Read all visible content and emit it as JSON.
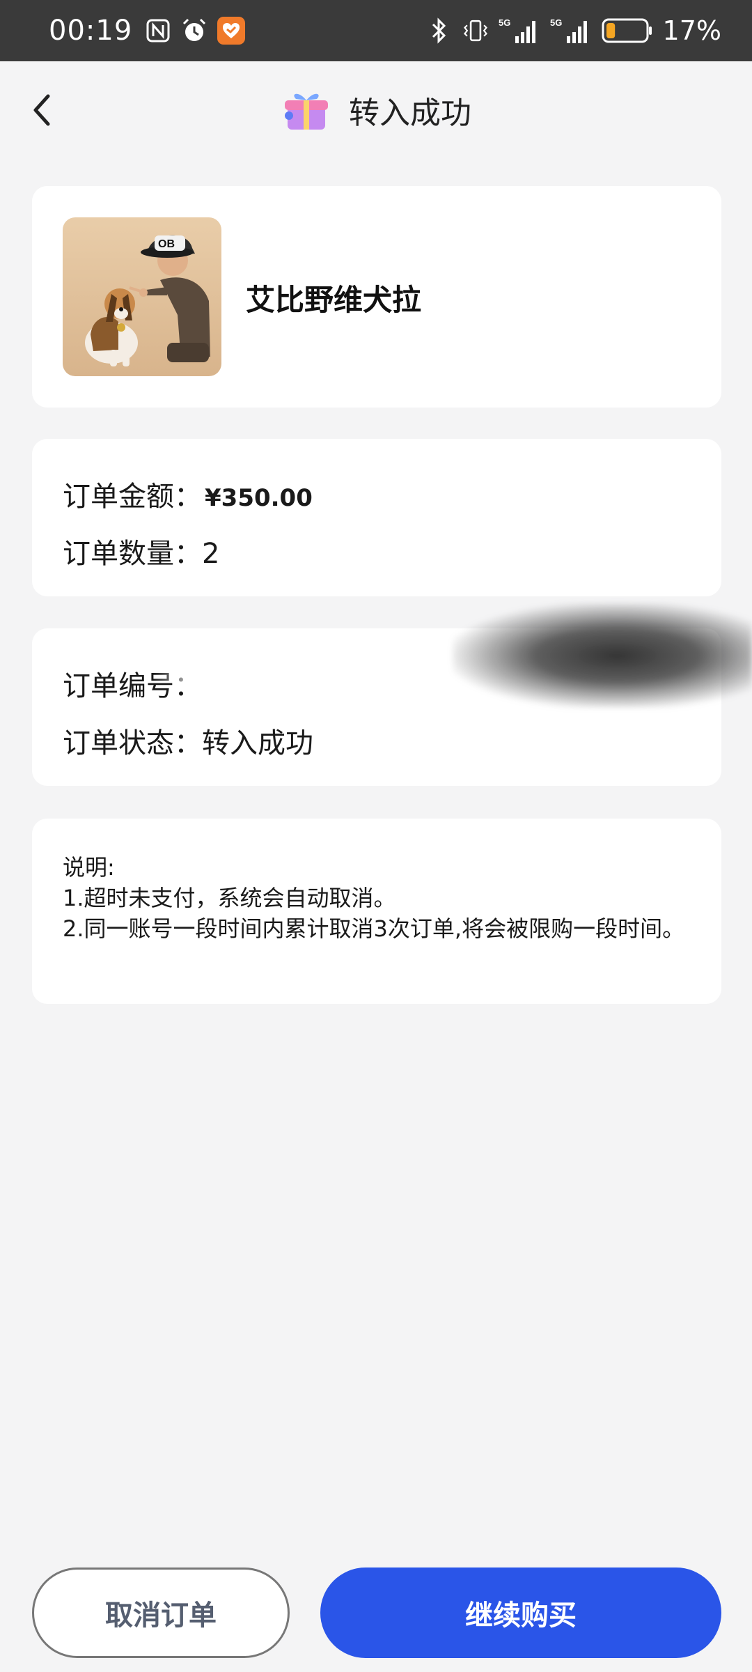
{
  "status_bar": {
    "time": "00:19",
    "battery_text": "17%",
    "network_1": "5G",
    "network_2": "5G",
    "icons": [
      "nfc-icon",
      "alarm-icon",
      "app-notification-icon",
      "bluetooth-icon",
      "vibrate-icon",
      "signal-icon",
      "signal-icon",
      "battery-icon"
    ],
    "battery_level": 0.17,
    "battery_color": "#f5a623"
  },
  "header": {
    "title": "转入成功",
    "back_icon": "chevron-left-icon",
    "logo_icon": "gift-icon"
  },
  "product": {
    "name": "艾比野维犬拉",
    "image_icon": "dog-and-man-illustration"
  },
  "order_summary": {
    "amount_label": "订单金额：",
    "amount_value": "¥350.00",
    "quantity_label": "订单数量：",
    "quantity_value": "2"
  },
  "order_info": {
    "number_label": "订单编号：",
    "status_label": "订单状态：",
    "status_value": "转入成功"
  },
  "note": {
    "title": "说明:",
    "line1": "1.超时未支付，系统会自动取消。",
    "line2": "2.同一账号一段时间内累计取消3次订单,将会被限购一段时间。"
  },
  "actions": {
    "cancel_label": "取消订单",
    "continue_label": "继续购买"
  },
  "colors": {
    "primary": "#2a55e8",
    "background": "#f4f4f5",
    "card": "#ffffff"
  }
}
